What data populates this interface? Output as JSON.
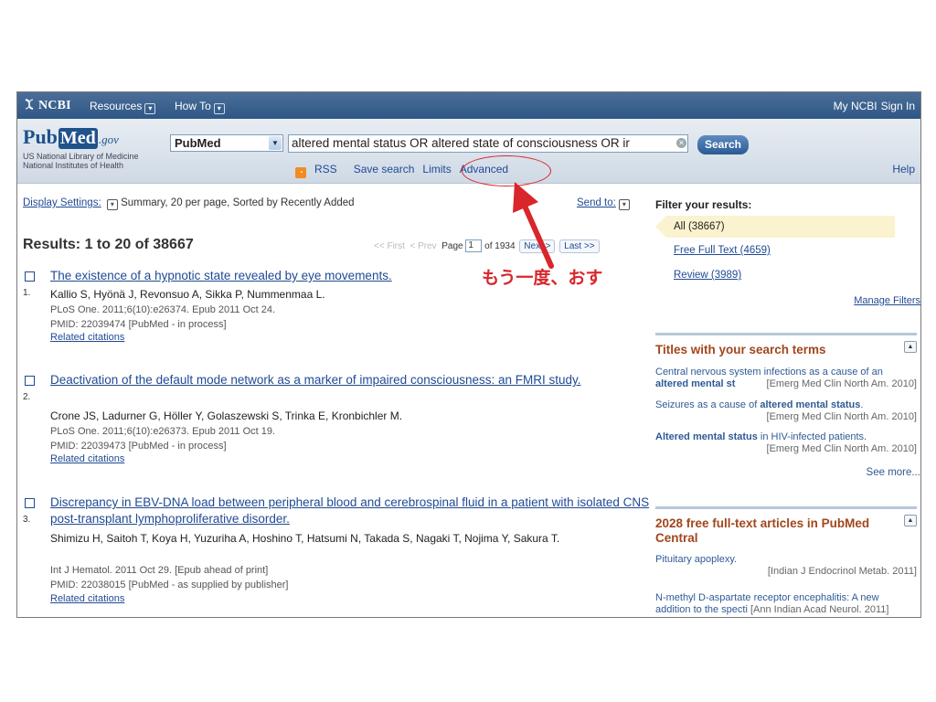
{
  "topbar": {
    "brand": "NCBI",
    "resources": "Resources",
    "howto": "How To",
    "mync bi": "My NCBI",
    "mync": "My NCBI",
    "signin": "Sign In"
  },
  "logo": {
    "pub": "Pub",
    "med": "Med",
    "gov": ".gov",
    "sub1": "US National Library of Medicine",
    "sub2": "National Institutes of Health"
  },
  "search": {
    "database": "PubMed",
    "query": "altered mental status OR altered state of consciousness OR ir",
    "button": "Search",
    "rss": "RSS",
    "save": "Save search",
    "limits": "Limits",
    "advanced": "Advanced",
    "help": "Help"
  },
  "display": {
    "settings_label": "Display Settings:",
    "settings_value": "Summary, 20 per page, Sorted by Recently Added",
    "sendto": "Send to:"
  },
  "results": {
    "title": "Results: 1 to 20 of 38667",
    "first": "<< First",
    "prev": "< Prev",
    "page_label": "Page",
    "page_value": "1",
    "of": "of 1934",
    "next": "Next >",
    "last": "Last >>"
  },
  "annotation": "もう一度、おす",
  "items": [
    {
      "num": "1.",
      "title": "The existence of a hypnotic state revealed by eye movements.",
      "authors": "Kallio S, Hyönä J, Revonsuo A, Sikka P, Nummenmaa L.",
      "journal": "PLoS One. 2011;6(10):e26374. Epub 2011 Oct 24.",
      "pmid": "PMID: 22039474 [PubMed - in process]",
      "related": "Related citations"
    },
    {
      "num": "2.",
      "title": "Deactivation of the default mode network as a marker of impaired consciousness: an FMRI study.",
      "authors": "Crone JS, Ladurner G, Höller Y, Golaszewski S, Trinka E, Kronbichler M.",
      "journal": "PLoS One. 2011;6(10):e26373. Epub 2011 Oct 19.",
      "pmid": "PMID: 22039473 [PubMed - in process]",
      "related": "Related citations"
    },
    {
      "num": "3.",
      "title": "Discrepancy in EBV-DNA load between peripheral blood and cerebrospinal fluid in a patient with isolated CNS post-transplant lymphoproliferative disorder.",
      "authors": "Shimizu H, Saitoh T, Koya H, Yuzuriha A, Hoshino T, Hatsumi N, Takada S, Nagaki T, Nojima Y, Sakura T.",
      "journal": "Int J Hematol. 2011 Oct 29. [Epub ahead of print]",
      "pmid": "PMID: 22038015 [PubMed - as supplied by publisher]",
      "related": "Related citations"
    }
  ],
  "sidebar": {
    "filter_label": "Filter your results:",
    "filters": [
      "All (38667)",
      "Free Full Text (4659)",
      "Review (3989)"
    ],
    "manage": "Manage Filters",
    "titles_heading": "Titles with your search terms",
    "titles": [
      {
        "pre": "Central nervous system infections as a cause of an ",
        "bold": "altered mental st",
        "journal": "[Emerg Med Clin North Am. 2010]"
      },
      {
        "pre": "Seizures as a cause of ",
        "bold": "altered mental status",
        "journal": "[Emerg Med Clin North Am. 2010]"
      },
      {
        "pre": "",
        "bold": "Altered mental status",
        "post": " in HIV-infected patients.",
        "journal": "[Emerg Med Clin North Am. 2010]"
      }
    ],
    "see_more": "See more...",
    "free_heading": "2028 free full-text articles in PubMed Central",
    "free": [
      {
        "title": "Pituitary apoplexy.",
        "journal": "[Indian J Endocrinol Metab. 2011]"
      },
      {
        "title": "N-methyl D-aspartate receptor encephalitis: A new addition to the specti",
        "journal": "[Ann Indian Acad Neurol. 2011]"
      }
    ]
  },
  "colors": {
    "topbar": "#2f5786",
    "link": "#1f4a94",
    "annotation": "#d8262b",
    "heading": "#a2461c",
    "filter_selected": "#fbf3cf"
  }
}
